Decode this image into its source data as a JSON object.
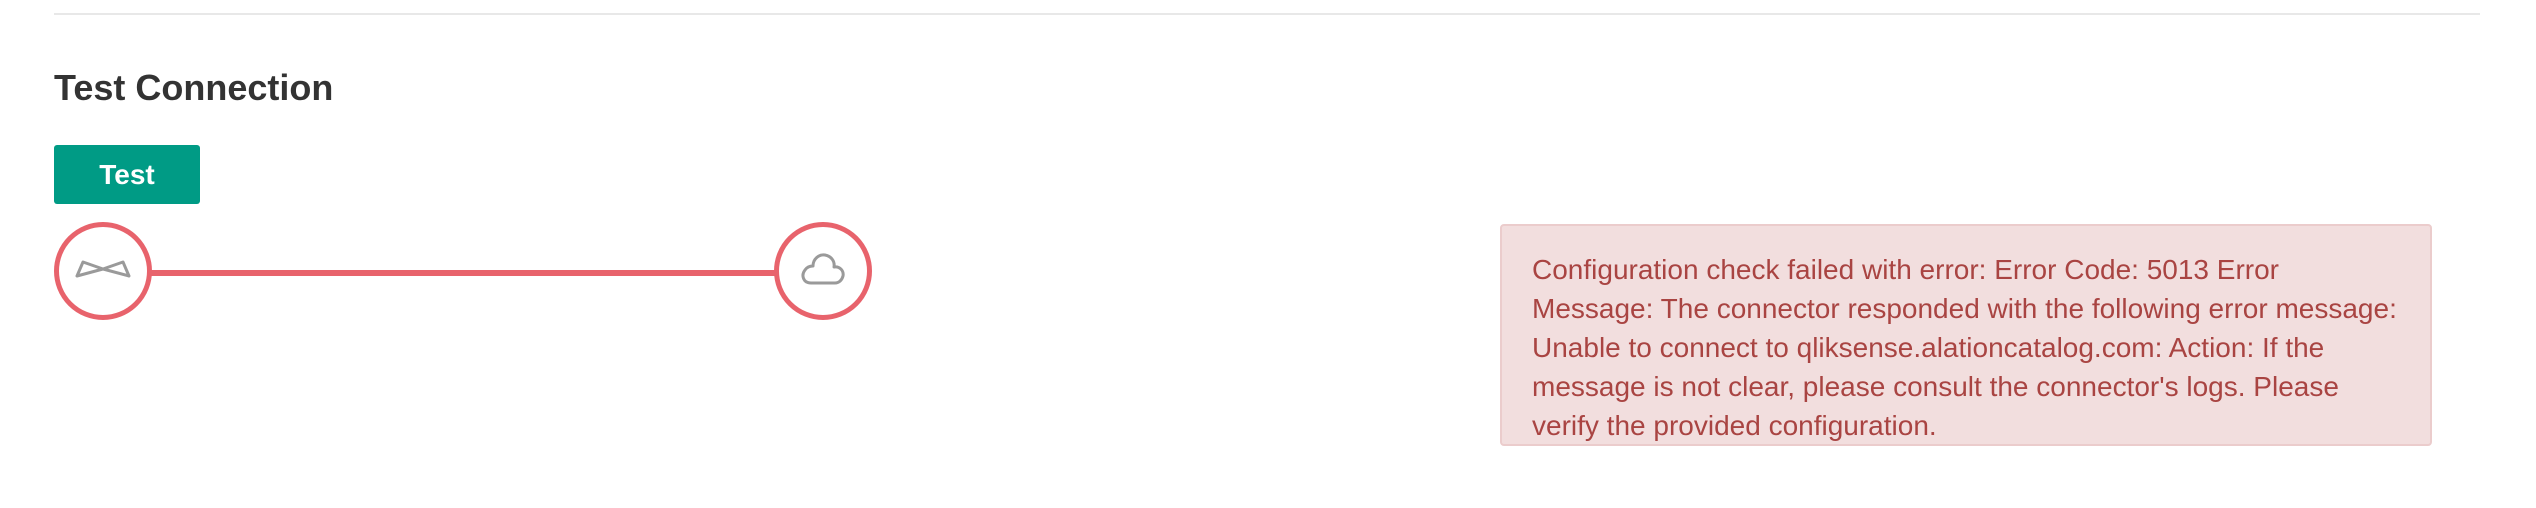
{
  "section": {
    "title": "Test Connection"
  },
  "test_button": {
    "label": "Test"
  },
  "connection": {
    "source_icon": "bowtie-connector-icon",
    "target_icon": "cloud-icon",
    "status_color": "#e8636c"
  },
  "error": {
    "message": "Configuration check failed with error: Error Code: 5013 Error Message: The connector responded with the following error message: Unable to connect to qliksense.alationcatalog.com: Action: If the message is not clear, please consult the connector's logs. Please verify the provided configuration."
  },
  "colors": {
    "accent": "#009b85",
    "error_text": "#a94442",
    "error_background": "#f2dede"
  }
}
